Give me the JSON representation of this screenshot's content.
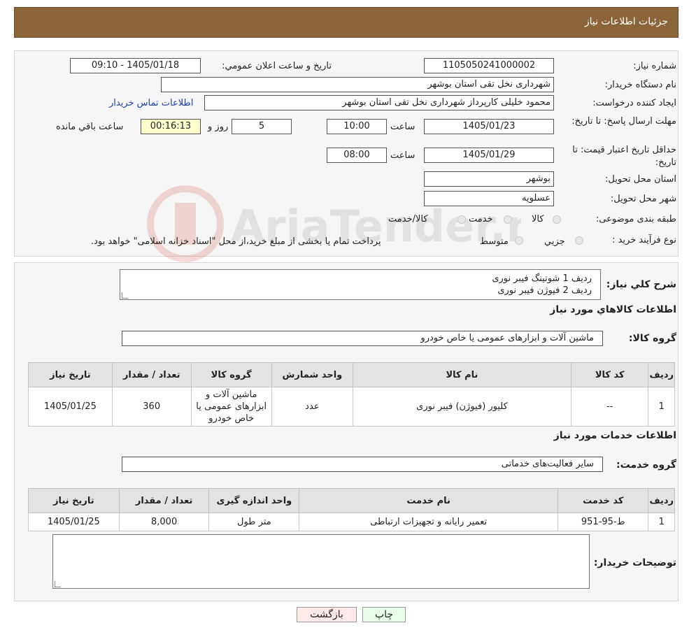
{
  "header": {
    "title": "جزئیات اطلاعات نیاز"
  },
  "watermark": {
    "text": "AriaTender.neT"
  },
  "info": {
    "need_number_label": "شماره نیاز:",
    "need_number": "1105050241000002",
    "announce_label": "تاریخ و ساعت اعلان عمومي:",
    "announce_value": "1405/01/18 - 09:10",
    "buyer_org_label": "نام دستگاه خريدار:",
    "buyer_org": "شهرداری نخل تقی استان بوشهر",
    "creator_label": "ايجاد کننده درخواست:",
    "creator": "محمود خلیلی کارپرداز شهرداری نخل تقی استان بوشهر",
    "contact_link": "اطلاعات تماس خريدار",
    "reply_deadline_label": "مهلت ارسال پاسخ: تا تاریخ:",
    "reply_date": "1405/01/23",
    "time_label": "ساعت",
    "reply_time": "10:00",
    "days": "5",
    "days_label": "روز و",
    "remaining_time": "00:16:13",
    "remaining_label": "ساعت باقي مانده",
    "validity_label": "حداقل تاریخ اعتبار قیمت: تا تاریخ:",
    "validity_date": "1405/01/29",
    "validity_time": "08:00",
    "province_label": "استان محل تحویل:",
    "province": "بوشهر",
    "city_label": "شهر محل تحویل:",
    "city": "عسلویه",
    "category_label": "طبقه بندی موضوعی:",
    "category_options": [
      "کالا",
      "خدمت",
      "کالا/خدمت"
    ],
    "process_label": "نوع فرآیند خرید :",
    "process_options": [
      "جزيي",
      "متوسط"
    ],
    "process_note": "پرداخت تمام یا بخشی از مبلغ خرید،از محل \"اسناد خزانه اسلامی\" خواهد بود."
  },
  "description": {
    "label": "شرح کلي نياز:",
    "lines": [
      "ردیف 1 شوتینگ فیبر نوری",
      "ردیف 2 فیوژن فیبر نوری"
    ]
  },
  "goods": {
    "section_title": "اطلاعات کالاهاي مورد نياز",
    "group_label": "گروه کالا:",
    "group_value": "ماشین آلات و ابزارهای عمومی یا خاص خودرو",
    "columns": [
      "رديف",
      "کد کالا",
      "نام کالا",
      "واحد شمارش",
      "گروه کالا",
      "تعداد / مقدار",
      "تاريخ نياز"
    ],
    "rows": [
      [
        "1",
        "--",
        "کلیور (فیوژن) فیبر نوری",
        "عدد",
        "ماشین آلات و ابزارهای عمومی یا خاص خودرو",
        "360",
        "1405/01/25"
      ]
    ]
  },
  "services": {
    "section_title": "اطلاعات خدمات مورد نياز",
    "group_label": "گروه خدمت:",
    "group_value": "سایر فعالیت‌های خدماتی",
    "columns": [
      "رديف",
      "کد خدمت",
      "نام خدمت",
      "واحد اندازه گيری",
      "تعداد / مقدار",
      "تاريخ نياز"
    ],
    "rows": [
      [
        "1",
        "ط-95-951",
        "تعمیر رایانه و تجهیزات ارتباطی",
        "متر طول",
        "8,000",
        "1405/01/25"
      ]
    ]
  },
  "buyer_notes": {
    "label": "توضيحات خريدار:",
    "value": ""
  },
  "buttons": {
    "print": "چاپ",
    "back": "بازگشت"
  }
}
